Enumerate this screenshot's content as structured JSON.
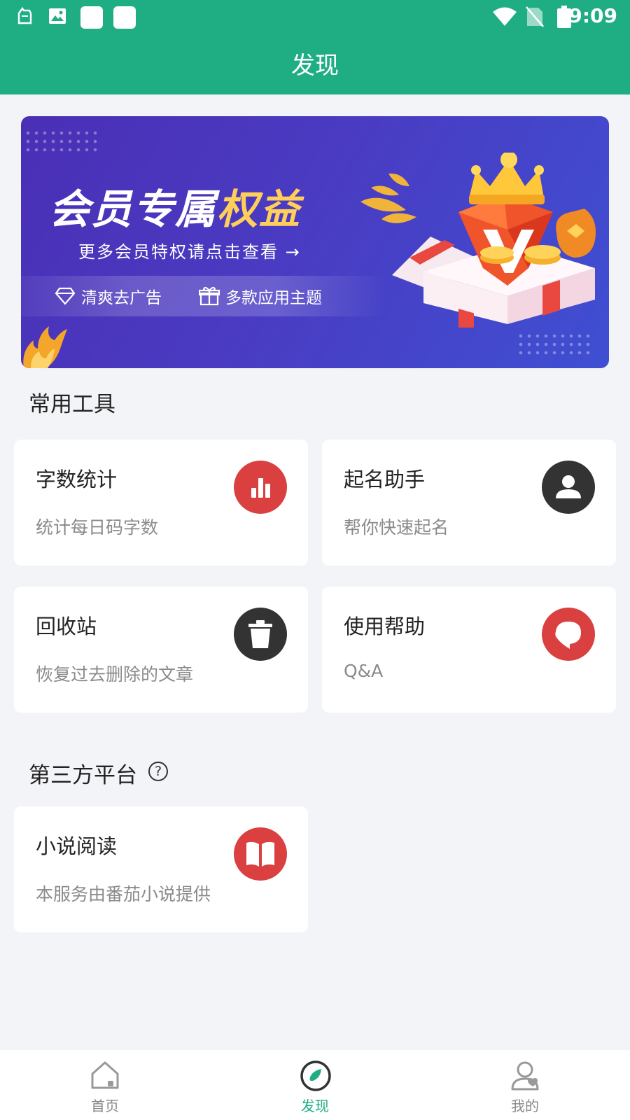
{
  "status_bar": {
    "time": "9:09",
    "icons": [
      "notification-icon",
      "image-icon",
      "app-square-icon",
      "app-square-icon",
      "wifi-icon",
      "no-sim-icon",
      "battery-icon"
    ]
  },
  "header": {
    "title": "发现"
  },
  "banner": {
    "title_part1": "会员专属",
    "title_part2": "权益",
    "subtitle": "更多会员特权请点击查看 →",
    "features": [
      {
        "icon": "diamond-icon",
        "label": "清爽去广告"
      },
      {
        "icon": "gift-icon",
        "label": "多款应用主题"
      }
    ]
  },
  "tools_section": {
    "title": "常用工具",
    "cards": [
      {
        "title": "字数统计",
        "subtitle": "统计每日码字数",
        "icon": "bar-chart-icon",
        "icon_color": "#d9403f"
      },
      {
        "title": "起名助手",
        "subtitle": "帮你快速起名",
        "icon": "person-icon",
        "icon_color": "#333333"
      },
      {
        "title": "回收站",
        "subtitle": "恢复过去删除的文章",
        "icon": "trash-icon",
        "icon_color": "#333333"
      },
      {
        "title": "使用帮助",
        "subtitle": "Q&A",
        "icon": "chat-bubble-icon",
        "icon_color": "#d9403f"
      }
    ]
  },
  "third_party_section": {
    "title": "第三方平台",
    "help_icon_glyph": "?",
    "cards": [
      {
        "title": "小说阅读",
        "subtitle": "本服务由番茄小说提供",
        "icon": "book-icon",
        "icon_color": "#d9403f"
      }
    ]
  },
  "bottom_nav": {
    "items": [
      {
        "label": "首页",
        "icon": "home-icon",
        "active": false
      },
      {
        "label": "发现",
        "icon": "compass-icon",
        "active": true
      },
      {
        "label": "我的",
        "icon": "profile-icon",
        "active": false
      }
    ]
  },
  "colors": {
    "primary": "#1fad84",
    "accent_red": "#d9403f",
    "dark_icon": "#333333",
    "background": "#f3f4f8"
  }
}
